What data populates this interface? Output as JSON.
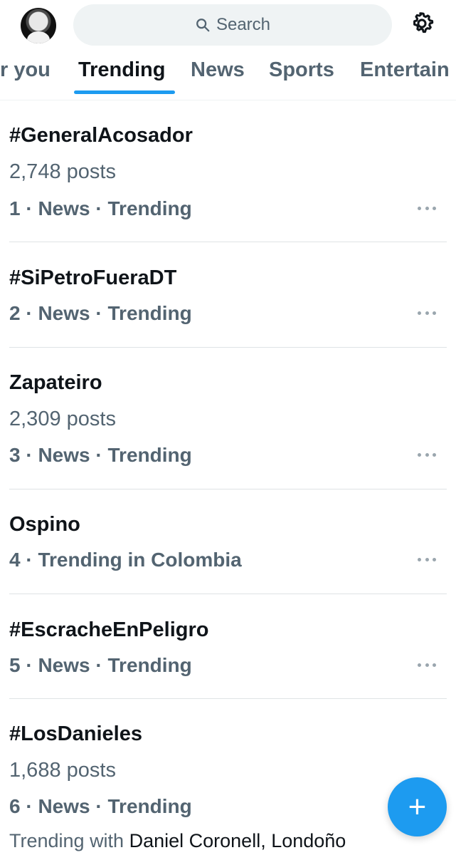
{
  "header": {
    "search_placeholder": "Search"
  },
  "tabs": [
    {
      "label": "r you"
    },
    {
      "label": "Trending"
    },
    {
      "label": "News"
    },
    {
      "label": "Sports"
    },
    {
      "label": "Entertain"
    }
  ],
  "trends": [
    {
      "title": "#GeneralAcosador",
      "posts": "2,748 posts",
      "meta": "1 · News · Trending"
    },
    {
      "title": "#SiPetroFueraDT",
      "posts": "",
      "meta": "2 · News · Trending"
    },
    {
      "title": "Zapateiro",
      "posts": "2,309 posts",
      "meta": "3 · News · Trending"
    },
    {
      "title": "Ospino",
      "posts": "",
      "meta": "4 · Trending in Colombia"
    },
    {
      "title": "#EscracheEnPeligro",
      "posts": "",
      "meta": "5 · News · Trending"
    },
    {
      "title": "#LosDanieles",
      "posts": "1,688 posts",
      "meta": "6 · News · Trending",
      "sub_prefix": "Trending with ",
      "sub_names": "Daniel Coronell, Londoño"
    }
  ],
  "fab": {
    "label": "+"
  }
}
